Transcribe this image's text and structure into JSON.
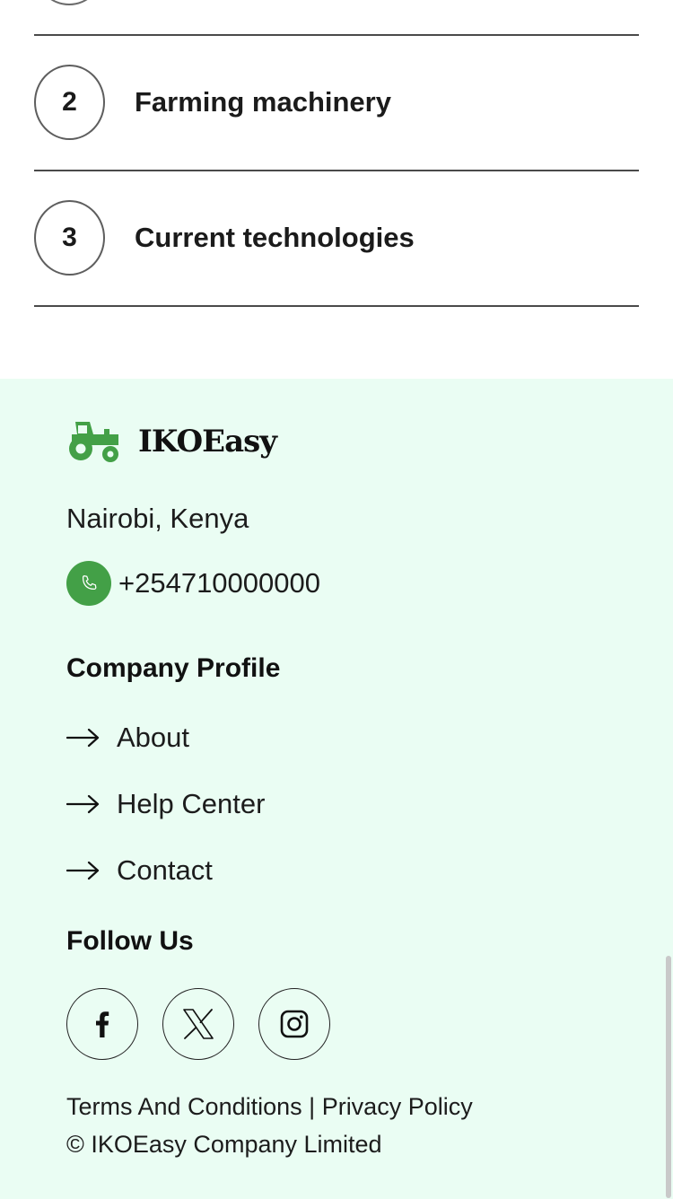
{
  "list": {
    "items": [
      {
        "number": "2",
        "label": "Farming machinery"
      },
      {
        "number": "3",
        "label": "Current technologies"
      }
    ]
  },
  "footer": {
    "brand": "IKOEasy",
    "location": "Nairobi, Kenya",
    "phone": "+254710000000",
    "company_profile": {
      "title": "Company Profile",
      "links": [
        "About",
        "Help Center",
        "Contact"
      ]
    },
    "follow_us": {
      "title": "Follow Us",
      "icons": [
        "facebook-icon",
        "x-icon",
        "instagram-icon"
      ]
    },
    "legal": {
      "terms": "Terms And Conditions",
      "separator": "|",
      "privacy": "Privacy Policy"
    },
    "copyright": "© IKOEasy Company Limited"
  },
  "colors": {
    "footer_bg": "#eafdf3",
    "accent_green": "#43a047"
  }
}
